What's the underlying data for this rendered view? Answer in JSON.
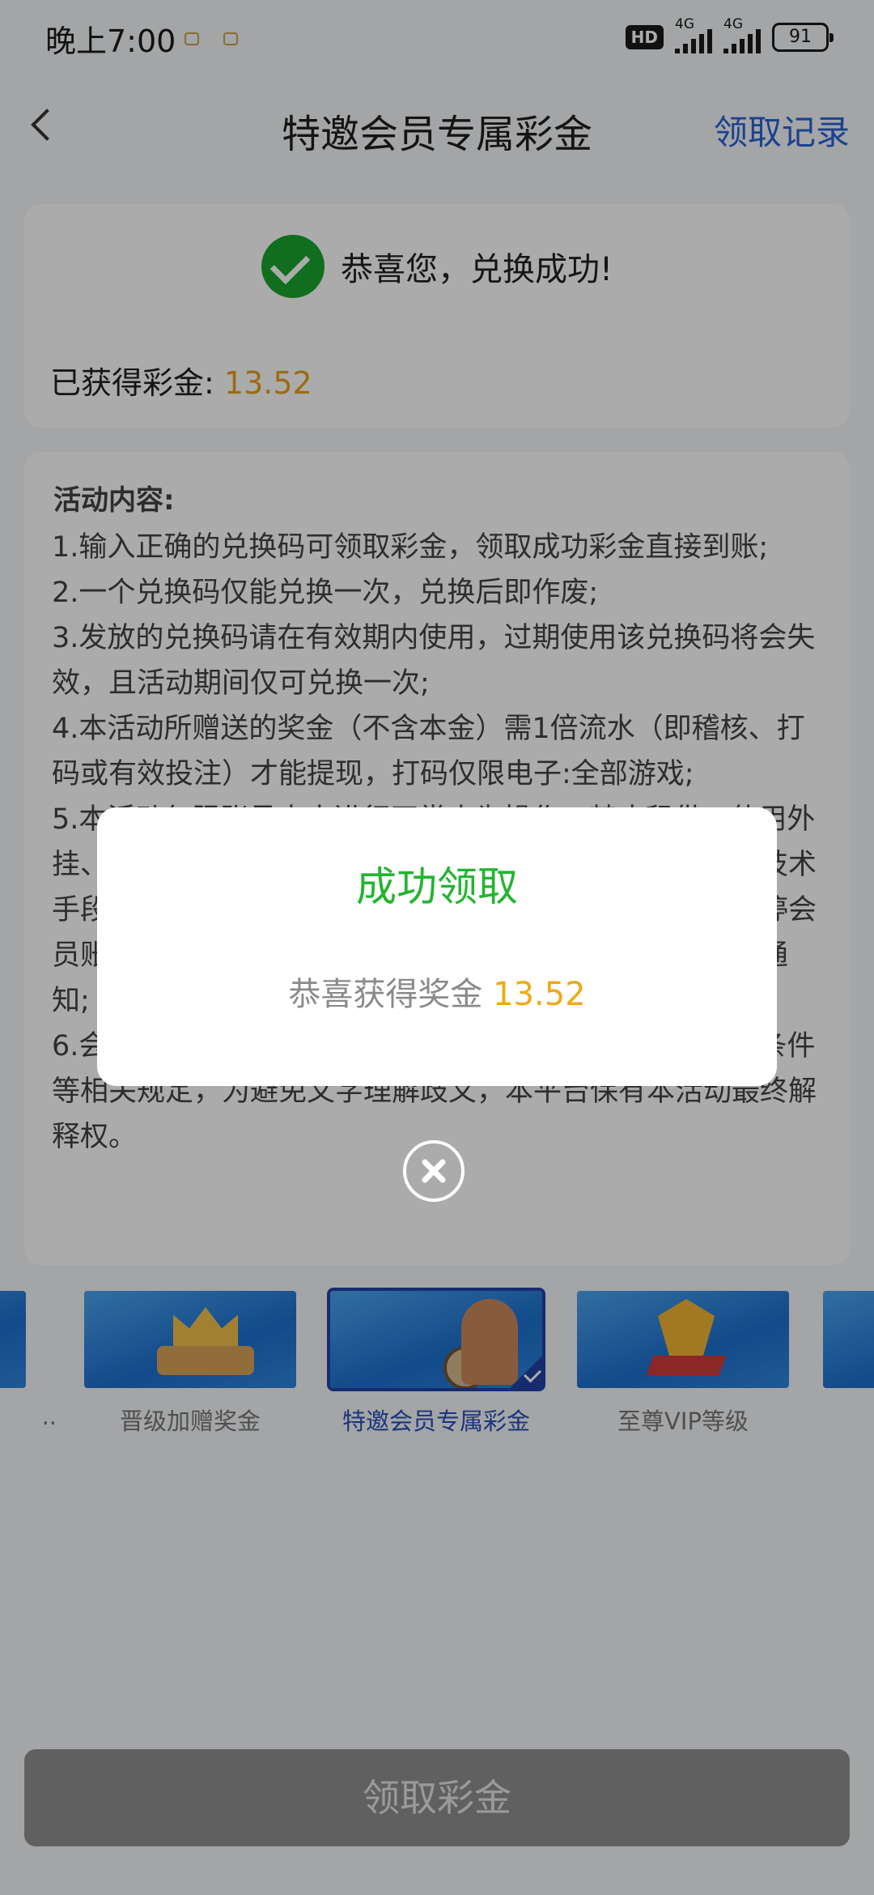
{
  "status_bar": {
    "time": "晚上7:00",
    "hd_badge": "HD",
    "network_1": "4G",
    "network_2": "4G",
    "battery": "91"
  },
  "header": {
    "title": "特邀会员专属彩金",
    "right_link": "领取记录"
  },
  "success_card": {
    "message": "恭喜您，兑换成功!",
    "earned_label": "已获得彩金: ",
    "earned_amount": "13.52"
  },
  "rules": {
    "title": "活动内容:",
    "items": [
      "1.输入正确的兑换码可领取彩金，领取成功彩金直接到账;",
      "2.一个兑换码仅能兑换一次，兑换后即作废;",
      "3.发放的兑换码请在有效期内使用，过期使用该兑换码将会失效，且活动期间仅可兑换一次;",
      "4.本活动所赠送的奖金（不含本金）需1倍流水（即稽核、打码或有效投注）才能提现，打码仅限电子:全部游戏;",
      "5.本活动仅限账号本人进行正常人为操作，禁止租借、使用外挂、机器人、不同账号对赌、互刷、套利、协议、漏洞、技术手段等，一经发现，平台有权取消奖励或扣除、冻结、暂停会员账号的使用，严重违规者还将列入黑名单，不另行特别通知;",
      "6.会员参与该活动时，本平台将默认会员同意且遵守对应条件等相关规定，为避免文字理解歧义，本平台保有本活动最终解释权。"
    ]
  },
  "carousel": {
    "items": [
      {
        "label": ".."
      },
      {
        "label": "晋级加赠奖金"
      },
      {
        "label": "特邀会员专属彩金"
      },
      {
        "label": "至尊VIP等级"
      }
    ]
  },
  "bottom_button": {
    "label": "领取彩金"
  },
  "modal": {
    "title": "成功领取",
    "message_prefix": "恭喜获得奖金 ",
    "amount": "13.52"
  },
  "icons": {
    "back": "chevron-left-icon",
    "success": "check-circle-icon",
    "close": "close-circle-icon"
  },
  "colors": {
    "accent_blue": "#2a63d6",
    "success_green": "#19a52e",
    "amount_orange": "#e6a11a"
  }
}
